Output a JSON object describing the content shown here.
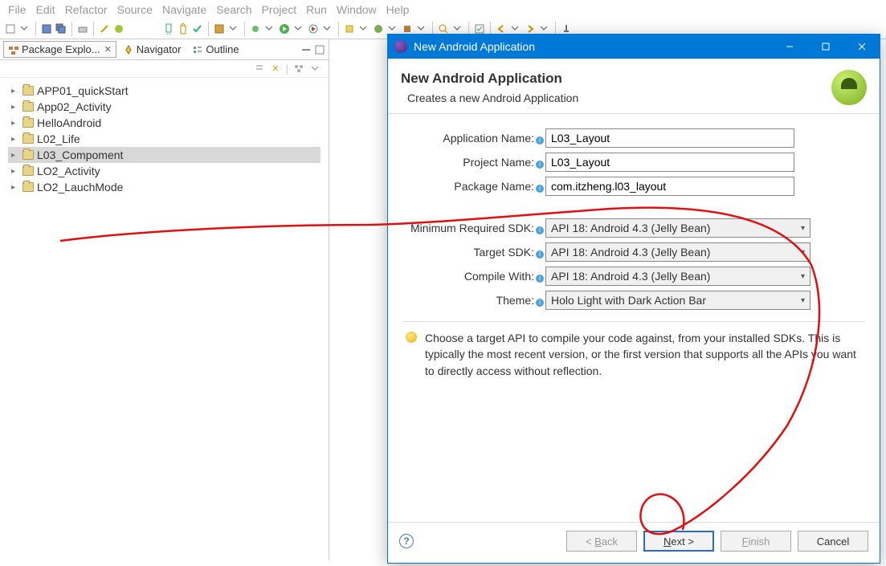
{
  "menu": [
    "File",
    "Edit",
    "Refactor",
    "Source",
    "Navigate",
    "Search",
    "Project",
    "Run",
    "Window",
    "Help"
  ],
  "views": {
    "tabs": [
      {
        "label": "Package Explo...",
        "active": true
      },
      {
        "label": "Navigator",
        "active": false
      },
      {
        "label": "Outline",
        "active": false
      }
    ]
  },
  "tree": [
    {
      "label": "APP01_quickStart",
      "selected": false
    },
    {
      "label": "App02_Activity",
      "selected": false
    },
    {
      "label": "HelloAndroid",
      "selected": false
    },
    {
      "label": "L02_Life",
      "selected": false
    },
    {
      "label": "L03_Compoment",
      "selected": true
    },
    {
      "label": "LO2_Activity",
      "selected": false
    },
    {
      "label": "LO2_LauchMode",
      "selected": false
    }
  ],
  "dialog": {
    "title": "New Android Application",
    "header_title": "New Android Application",
    "header_subtitle": "Creates a new Android Application",
    "fields": {
      "app_name_label": "Application Name:",
      "app_name_value": "L03_Layout",
      "project_name_label": "Project Name:",
      "project_name_value": "L03_Layout",
      "package_name_label": "Package Name:",
      "package_name_value": "com.itzheng.l03_layout",
      "min_sdk_label": "Minimum Required SDK:",
      "min_sdk_value": "API 18: Android 4.3 (Jelly Bean)",
      "target_sdk_label": "Target SDK:",
      "target_sdk_value": "API 18: Android 4.3 (Jelly Bean)",
      "compile_label": "Compile With:",
      "compile_value": "API 18: Android 4.3 (Jelly Bean)",
      "theme_label": "Theme:",
      "theme_value": "Holo Light with Dark Action Bar"
    },
    "hint": "Choose a target API to compile your code against, from your installed SDKs. This is typically the most recent version, or the first version that supports all the APIs you want to directly access without reflection.",
    "buttons": {
      "back": "< Back",
      "next": "Next >",
      "finish": "Finish",
      "cancel": "Cancel"
    }
  }
}
